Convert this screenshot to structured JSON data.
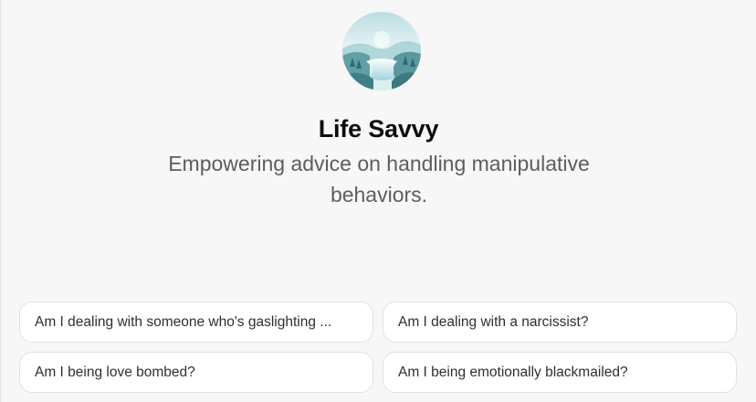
{
  "gpt": {
    "name": "Life Savvy",
    "description": "Empowering advice on handling manipulative behaviors.",
    "avatar_icon": "lake-landscape-avatar"
  },
  "suggestions": [
    {
      "label": "Am I dealing with someone who's gaslighting ..."
    },
    {
      "label": "Am I dealing with a narcissist?"
    },
    {
      "label": "Am I being love bombed?"
    },
    {
      "label": "Am I being emotionally blackmailed?"
    }
  ],
  "colors": {
    "background": "#f7f7f7",
    "title": "#0d0d0d",
    "description": "#5d5d5d",
    "chip_border": "#e2e2e2"
  }
}
